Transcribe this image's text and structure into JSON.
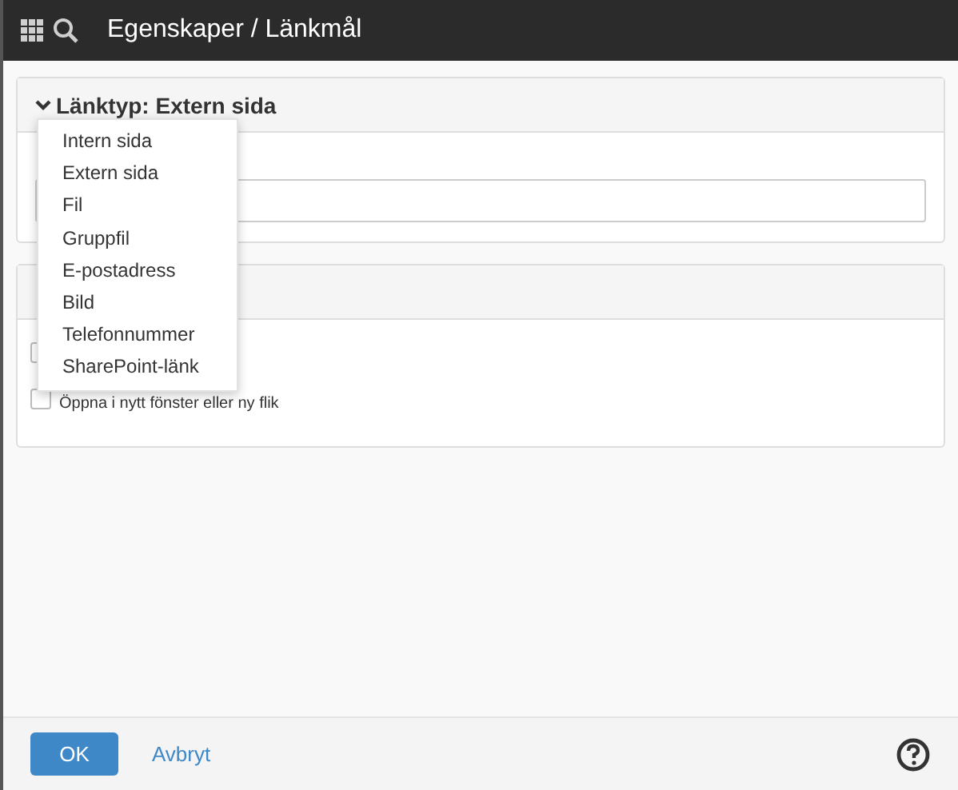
{
  "header": {
    "title": "Egenskaper / Länkmål"
  },
  "link_type_panel": {
    "title": "Länktyp: Extern sida",
    "expanded": true,
    "dropdown": [
      {
        "label": "Intern sida",
        "selected": false
      },
      {
        "label": "Extern sida",
        "selected": false
      },
      {
        "label": "Fil",
        "selected": false
      },
      {
        "label": "Gruppfil",
        "selected": false
      },
      {
        "label": "E-postadress",
        "selected": false
      },
      {
        "label": "Bild",
        "selected": false
      },
      {
        "label": "Telefonnummer",
        "selected": false
      },
      {
        "label": "SharePoint-länk",
        "selected": false
      }
    ]
  },
  "options_panel": {
    "checkboxes": [
      {
        "checked": false
      },
      {
        "label": "Öppna i nytt fönster eller ny flik",
        "checked": false
      }
    ]
  },
  "footer": {
    "ok": "OK",
    "cancel": "Avbryt"
  }
}
